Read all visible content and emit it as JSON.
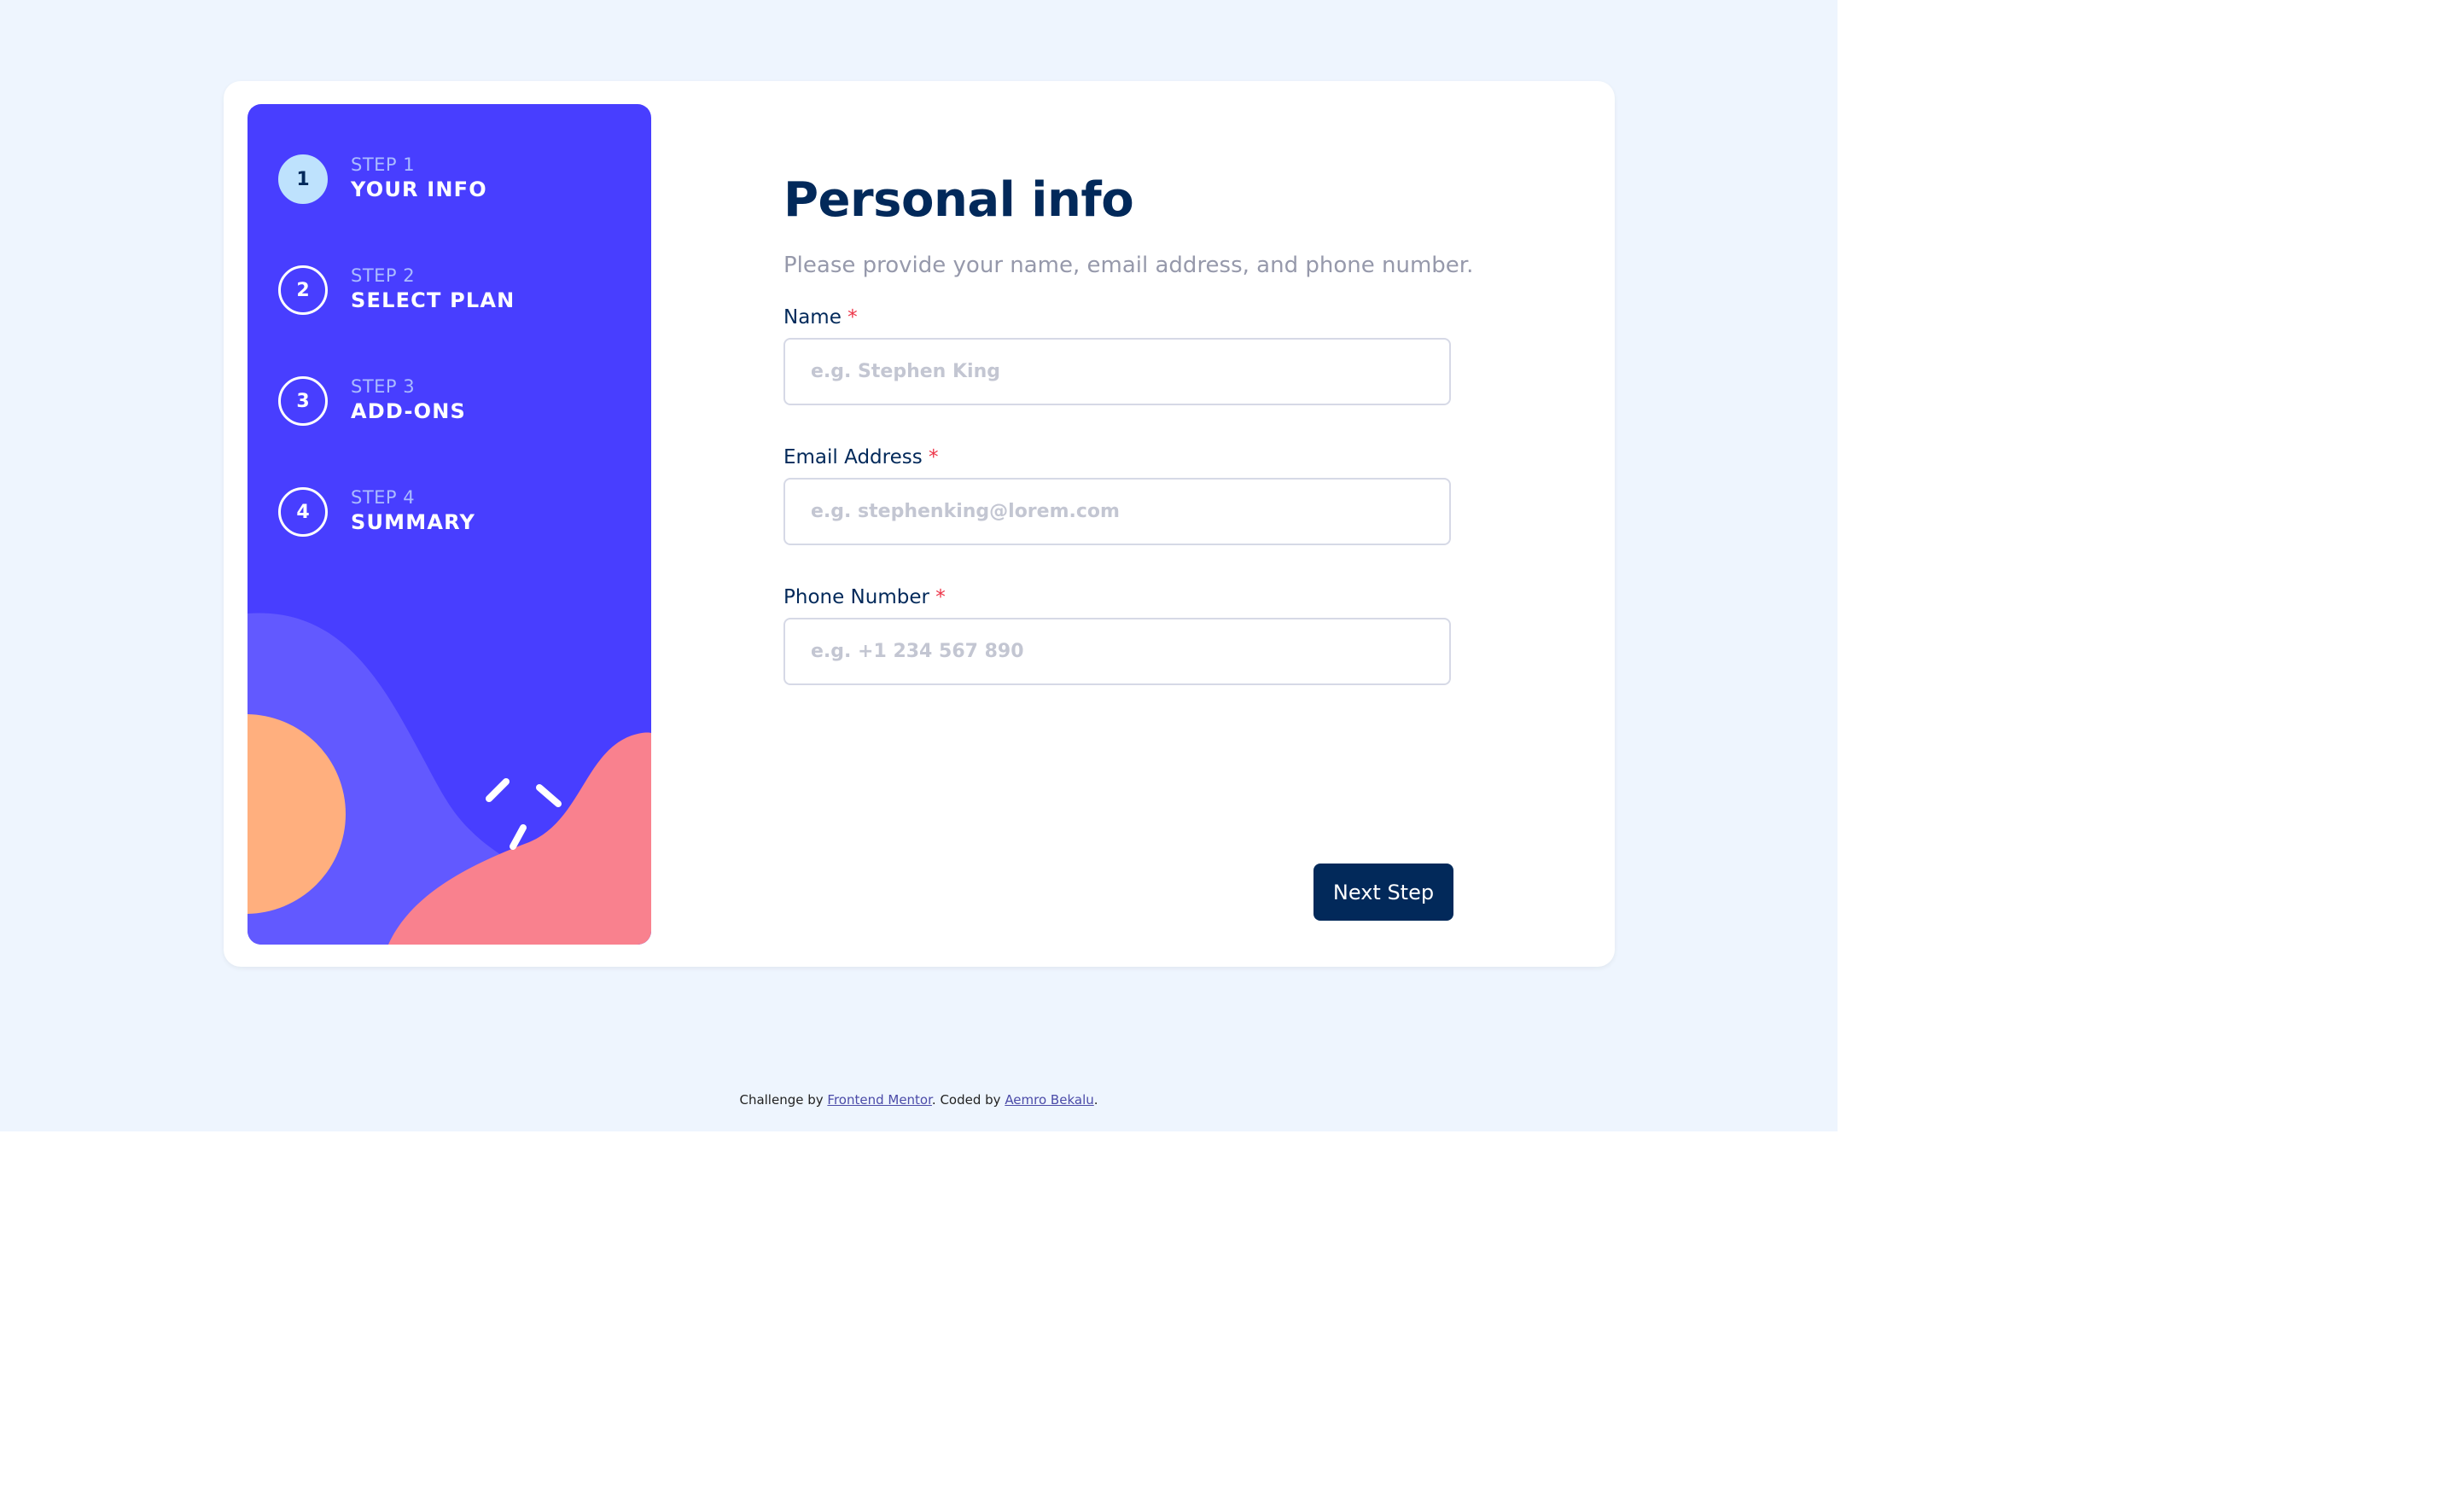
{
  "colors": {
    "page_background": "#eef5fe",
    "sidebar_background": "#483eff",
    "active_step": "#bee2fd",
    "primary_text": "#02295a",
    "subtitle_text": "#9699ab",
    "required_marker": "#ed3548",
    "input_border": "#d6d9e6",
    "button_background": "#02295a",
    "shape_orange": "#ffaf7e",
    "shape_pink": "#f9818e",
    "shape_purple": "#6259ff"
  },
  "sidebar": {
    "steps": [
      {
        "number": "1",
        "step_label": "STEP 1",
        "title": "YOUR INFO",
        "active": true
      },
      {
        "number": "2",
        "step_label": "STEP 2",
        "title": "SELECT PLAN",
        "active": false
      },
      {
        "number": "3",
        "step_label": "STEP 3",
        "title": "ADD-ONS",
        "active": false
      },
      {
        "number": "4",
        "step_label": "STEP 4",
        "title": "SUMMARY",
        "active": false
      }
    ]
  },
  "form": {
    "title": "Personal info",
    "subtitle": "Please provide your name, email address, and phone number.",
    "required_marker": "*",
    "fields": [
      {
        "label": "Name",
        "placeholder": "e.g. Stephen King",
        "value": ""
      },
      {
        "label": "Email Address",
        "placeholder": "e.g. stephenking@lorem.com",
        "value": ""
      },
      {
        "label": "Phone Number",
        "placeholder": "e.g. +1 234 567 890",
        "value": ""
      }
    ],
    "next_label": "Next Step"
  },
  "footer": {
    "prefix": "Challenge by ",
    "challenge_link": "Frontend Mentor",
    "middle": ". Coded by ",
    "author_link": "Aemro Bekalu",
    "suffix": "."
  }
}
